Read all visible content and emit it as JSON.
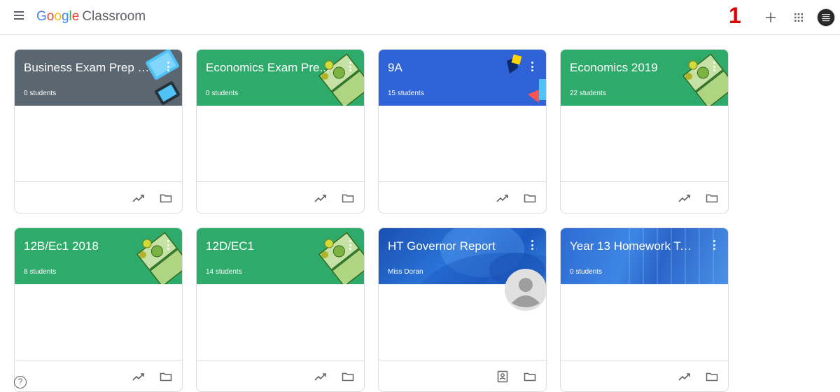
{
  "app": {
    "brand_google": [
      "G",
      "o",
      "o",
      "g",
      "l",
      "e"
    ],
    "brand_colors": [
      "#4285F4",
      "#EA4335",
      "#FBBC05",
      "#4285F4",
      "#34A853",
      "#EA4335"
    ],
    "product_name": "Classroom",
    "marker": "1",
    "top_icons": [
      "menu-icon",
      "add-icon",
      "apps-grid-icon",
      "account-avatar"
    ]
  },
  "colors": {
    "slate": "#5b6770",
    "green": "#2eab6b",
    "blue": "#2f62d6",
    "divider": "#e0e0e0"
  },
  "classes": [
    {
      "title": "Business Exam Prep 2...",
      "subtitle": "0 students",
      "theme": "slate"
    },
    {
      "title": "Economics Exam Pre...",
      "subtitle": "0 students",
      "theme": "green"
    },
    {
      "title": "9A",
      "subtitle": "15 students",
      "theme": "blue"
    },
    {
      "title": "Economics 2019",
      "subtitle": "22 students",
      "theme": "green"
    },
    {
      "title": "12B/Ec1 2018",
      "subtitle": "8 students",
      "theme": "green"
    },
    {
      "title": "12D/EC1",
      "subtitle": "14 students",
      "theme": "green"
    },
    {
      "title": "HT Governor Report",
      "subtitle": "Miss Doran",
      "theme": "report"
    },
    {
      "title": "Year 13 Homework Ta...",
      "subtitle": "0 students",
      "theme": "hw"
    }
  ],
  "help_label": "?"
}
